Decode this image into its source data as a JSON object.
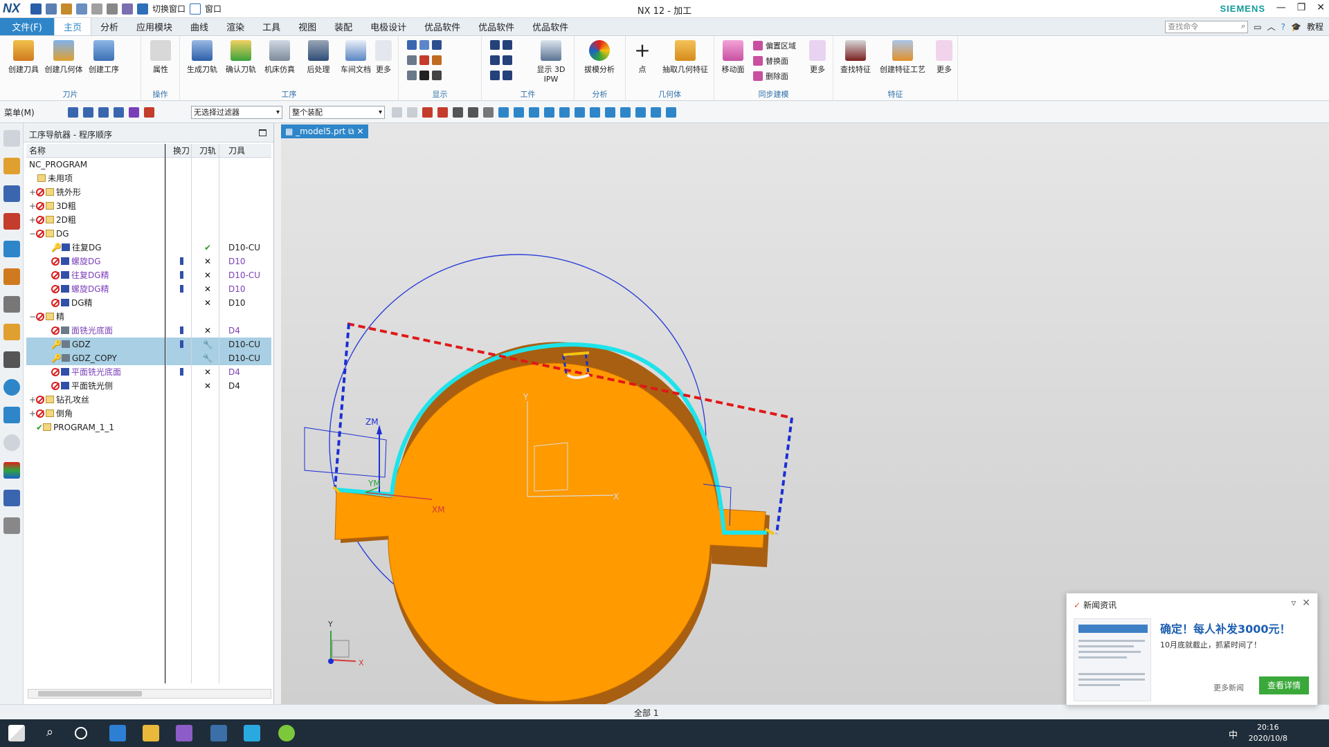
{
  "titlebar": {
    "logo": "NX",
    "switch_window": "切换窗口",
    "window": "窗口",
    "title": "NX 12 - 加工",
    "brand": "SIEMENS",
    "tutorial": "教程"
  },
  "tabs": {
    "file": "文件(F)",
    "items": [
      "主页",
      "分析",
      "应用模块",
      "曲线",
      "渲染",
      "工具",
      "视图",
      "装配",
      "电极设计",
      "优品软件",
      "优品软件",
      "优品软件"
    ],
    "search_placeholder": "查找命令"
  },
  "ribbon": {
    "groups": {
      "tool": "刀片",
      "ops": "操作",
      "process": "工序",
      "display": "显示",
      "workpiece": "工件",
      "analysis": "分析",
      "geometry": "几何体",
      "sync": "同步建模",
      "feature": "特征"
    },
    "buttons": {
      "create_tool": "创建刀具",
      "create_geom": "创建几何体",
      "create_op": "创建工序",
      "attribute": "属性",
      "gen_path": "生成刀轨",
      "verify_path": "确认刀轨",
      "machine_sim": "机床仿真",
      "postprocess": "后处理",
      "shop_doc": "车间文档",
      "more1": "更多",
      "show_ipw": "显示 3D IPW",
      "draft_analysis": "拔模分析",
      "point": "点",
      "extract_geom": "抽取几何特征",
      "move_face": "移动面",
      "offset_region": "偏置区域",
      "replace_face": "替换面",
      "delete_face": "删除面",
      "more2": "更多",
      "find_feature": "查找特征",
      "create_feature_process": "创建特征工艺",
      "more3": "更多"
    }
  },
  "toolbar2": {
    "menu": "菜单(M)",
    "filter": "无选择过滤器",
    "assembly": "整个装配"
  },
  "navigator": {
    "title": "工序导航器 - 程序顺序",
    "columns": {
      "name": "名称",
      "swap": "换刀",
      "path": "刀轨",
      "tool": "刀具"
    },
    "rows": [
      {
        "name": "NC_PROGRAM",
        "level": 0,
        "tool": ""
      },
      {
        "name": "未用项",
        "level": 1,
        "tool": ""
      },
      {
        "name": "铣外形",
        "level": 1,
        "tool": ""
      },
      {
        "name": "3D粗",
        "level": 1,
        "tool": ""
      },
      {
        "name": "2D粗",
        "level": 1,
        "tool": ""
      },
      {
        "name": "DG",
        "level": 1,
        "tool": ""
      },
      {
        "name": "往复DG",
        "level": 2,
        "tool": "D10-CU"
      },
      {
        "name": "螺旋DG",
        "level": 2,
        "tool": "D10"
      },
      {
        "name": "往复DG精",
        "level": 2,
        "tool": "D10-CU"
      },
      {
        "name": "螺旋DG精",
        "level": 2,
        "tool": "D10"
      },
      {
        "name": "DG精",
        "level": 2,
        "tool": "D10"
      },
      {
        "name": "精",
        "level": 1,
        "tool": ""
      },
      {
        "name": "面铣光底面",
        "level": 2,
        "tool": "D4"
      },
      {
        "name": "GDZ",
        "level": 2,
        "tool": "D10-CU"
      },
      {
        "name": "GDZ_COPY",
        "level": 2,
        "tool": "D10-CU"
      },
      {
        "name": "平面铣光底面",
        "level": 2,
        "tool": "D4"
      },
      {
        "name": "平面铣光侧",
        "level": 2,
        "tool": "D4"
      },
      {
        "name": "钻孔攻丝",
        "level": 1,
        "tool": ""
      },
      {
        "name": "倒角",
        "level": 1,
        "tool": ""
      },
      {
        "name": "PROGRAM_1_1",
        "level": 1,
        "tool": ""
      }
    ]
  },
  "viewport": {
    "file_tab": "_model5.prt",
    "labels": {
      "zm": "ZM",
      "ym": "YM",
      "xm": "XM",
      "y": "Y",
      "x": "X",
      "ty": "Y",
      "tx": "X"
    },
    "colors": {
      "part": "#ff9a00",
      "toolpath_cyan": "#1ee3ea",
      "rapid_red": "#e01818",
      "rapid_blue": "#1a2fd4"
    }
  },
  "statusbar": {
    "text": "全部 1"
  },
  "news": {
    "header": "新闻资讯",
    "headline": "确定！每人补发3000元！",
    "sub": "10月底就截止，抓紧时间了！",
    "more": "更多新闻",
    "detail": "查看详情"
  },
  "taskbar": {
    "time": "20:16",
    "date": "2020/10/8",
    "ime": "中"
  }
}
